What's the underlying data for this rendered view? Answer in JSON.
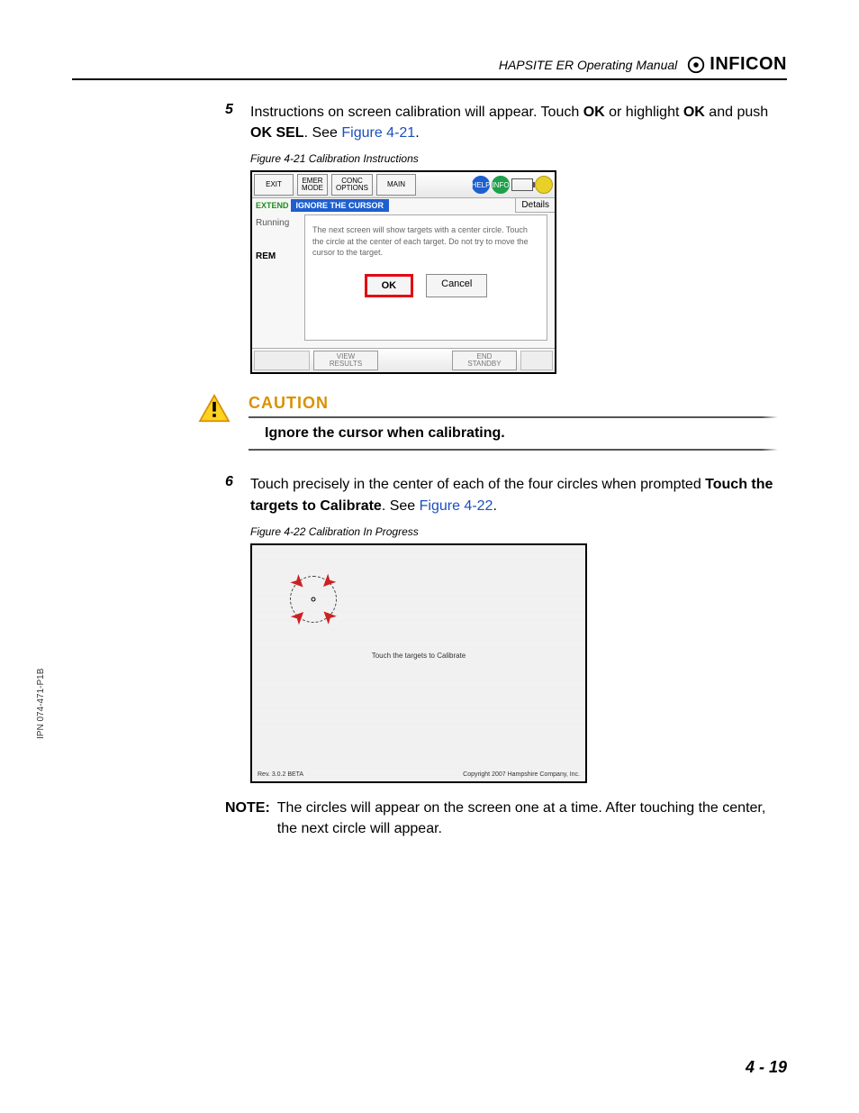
{
  "side_ipn": "IPN 074-471-P1B",
  "header": {
    "title": "HAPSITE ER Operating Manual",
    "brand": "INFICON"
  },
  "step5": {
    "num": "5",
    "t1": "Instructions on screen calibration will appear. Touch ",
    "b1": "OK",
    "t2": " or highlight ",
    "b2": "OK",
    "t3": " and push ",
    "b3": "OK SEL",
    "t4": ". See ",
    "link": "Figure 4-21",
    "t5": "."
  },
  "fig21": {
    "caption": "Figure 4-21  Calibration Instructions",
    "top": {
      "exit": "EXIT",
      "emer1": "EMER",
      "emer2": "MODE",
      "conc1": "CONC",
      "conc2": "OPTIONS",
      "main": "MAIN",
      "help": "HELP",
      "info": "INFO"
    },
    "ext": "EXTEND",
    "ignore": "IGNORE THE CURSOR",
    "details": "Details",
    "running": "Running",
    "rem": "REM",
    "dialog": "The next screen will show targets with a center circle. Touch the circle at the center of each target. Do not try to move the cursor to the target.",
    "ok": "OK",
    "cancel": "Cancel",
    "view1": "VIEW",
    "view2": "RESULTS",
    "end1": "END",
    "end2": "STANDBY"
  },
  "caution": {
    "title": "CAUTION",
    "text": "Ignore the cursor when calibrating."
  },
  "step6": {
    "num": "6",
    "t1": "Touch precisely in the center of each of the four circles when prompted ",
    "b1": "Touch the targets to Calibrate",
    "t2": ". See ",
    "link": "Figure 4-22",
    "t3": "."
  },
  "fig22": {
    "caption": "Figure 4-22  Calibration In Progress",
    "text": "Touch the targets to Calibrate",
    "bl": "Rev. 3.0.2 BETA",
    "br": "Copyright 2007 Hampshire Company, Inc."
  },
  "note": {
    "label": "NOTE:",
    "text": "The circles will appear on the screen one at a time. After touching the center, the next circle will appear."
  },
  "footer": "4 - 19"
}
